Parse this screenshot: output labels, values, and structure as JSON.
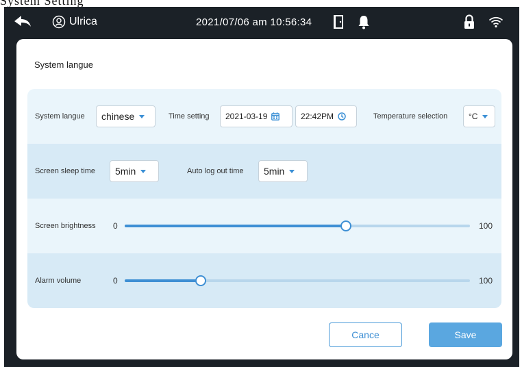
{
  "page_caption": "System Setting",
  "status_bar": {
    "user_name": "Ulrica",
    "datetime": "2021/07/06 am 10:56:34",
    "icons": [
      "back-arrow-icon",
      "user-icon",
      "door-icon",
      "bell-icon",
      "lock-icon",
      "wifi-icon"
    ]
  },
  "panel": {
    "title": "System langue",
    "language": {
      "label": "System langue",
      "value": "chinese"
    },
    "time_setting": {
      "label": "Time setting",
      "date": "2021-03-19",
      "time": "22:42PM"
    },
    "temperature": {
      "label": "Temperature selection",
      "value": "°C"
    },
    "screen_sleep": {
      "label": "Screen sleep time",
      "value": "5min"
    },
    "auto_logout": {
      "label": "Auto log out time",
      "value": "5min"
    },
    "brightness": {
      "label": "Screen brightness",
      "min": "0",
      "max": "100",
      "value": 64
    },
    "alarm_volume": {
      "label": "Alarm volume",
      "min": "0",
      "max": "100",
      "value": 22
    }
  },
  "buttons": {
    "cancel": "Cance",
    "save": "Save"
  },
  "colors": {
    "accent": "#3e8fd4",
    "save_bg": "#5aa7e0",
    "status_bar": "#1b2127",
    "row_light": "#eaf5fb",
    "row_dark": "#d7eaf6"
  }
}
